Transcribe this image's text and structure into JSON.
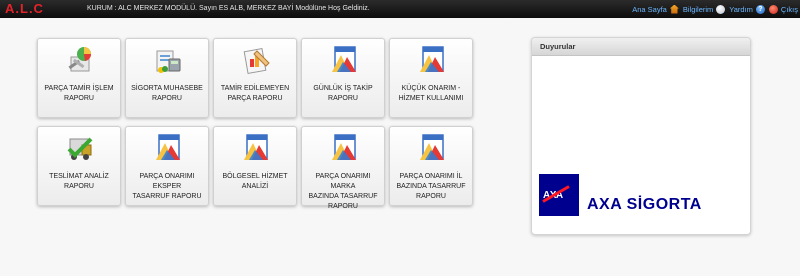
{
  "header": {
    "logo": "A.L.C",
    "welcome": "KURUM : ALC MERKEZ MODÜLÜ. Sayın ES ALB, MERKEZ BAYİ Modülüne Hoş Geldiniz.",
    "nav": {
      "home": "Ana Sayfa",
      "info": "Bilgilerim",
      "help": "Yardım",
      "logout": "Çıkış"
    }
  },
  "tiles": [
    {
      "label": "PARÇA TAMİR İŞLEM\nRAPORU",
      "icon": "repair-report-icon"
    },
    {
      "label": "SİGORTA MUHASEBE\nRAPORU",
      "icon": "insurance-accounting-icon"
    },
    {
      "label": "TAMİR EDİLEMEYEN\nPARÇA RAPORU",
      "icon": "unrepairable-parts-icon"
    },
    {
      "label": "GÜNLÜK İŞ TAKİP\nRAPORU",
      "icon": "chart-report-icon"
    },
    {
      "label": "KÜÇÜK ONARIM -\nHİZMET KULLANIMI",
      "icon": "chart-report-icon"
    },
    {
      "label": "TESLİMAT ANALİZ\nRAPORU",
      "icon": "delivery-analysis-icon"
    },
    {
      "label": "PARÇA ONARIMI EKSPER\nTASARRUF RAPORU",
      "icon": "chart-report-icon"
    },
    {
      "label": "BÖLGESEL HİZMET\nANALİZİ",
      "icon": "chart-report-icon"
    },
    {
      "label": "PARÇA ONARIMI MARKA\nBAZINDA TASARRUF\nRAPORU",
      "icon": "chart-report-icon"
    },
    {
      "label": "PARÇA ONARIMI İL\nBAZINDA TASARRUF\nRAPORU",
      "icon": "chart-report-icon"
    }
  ],
  "announcements": {
    "title": "Duyurular",
    "logo_text": "AXA",
    "brand_text": "AXA SİGORTA"
  },
  "colors": {
    "logo": "#e3222a",
    "nav_link": "#6bb6ff",
    "axa_blue": "#00008f",
    "axa_red": "#ff1721"
  }
}
